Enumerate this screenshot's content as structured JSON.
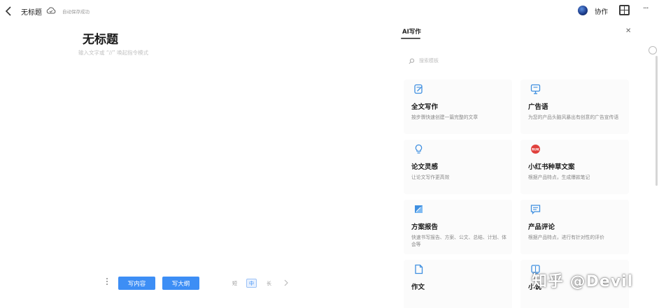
{
  "topbar": {
    "doc_name": "无标题",
    "save_status": "自动保存成功",
    "collab_label": "协作"
  },
  "editor": {
    "title": "无标题",
    "placeholder": "输入文字或 “//” 唤起指令模式"
  },
  "bottom_toolbar": {
    "write_content_label": "写内容",
    "write_outline_label": "写大纲",
    "lengths": [
      "短",
      "中",
      "长"
    ],
    "selected_length": "中"
  },
  "ai_panel": {
    "tab_label": "AI写作",
    "search_placeholder": "搜索模板",
    "cards": [
      {
        "title": "全文写作",
        "desc": "按步骤快速创建一篇完整的文章",
        "icon": "pencil-doc-icon"
      },
      {
        "title": "广告语",
        "desc": "为您的产品头脑风暴出有创意的广告宣传语",
        "icon": "billboard-icon"
      },
      {
        "title": "论文灵感",
        "desc": "让论文写作更高效",
        "icon": "lightbulb-icon"
      },
      {
        "title": "小红书种草文案",
        "desc": "根据产品特点，生成爆款笔记",
        "icon": "xiaohongshu-icon",
        "icon_text": "RUK"
      },
      {
        "title": "方案报告",
        "desc": "快速书写报告、方案、公文、总结、计划、体会等",
        "icon": "report-icon"
      },
      {
        "title": "产品评论",
        "desc": "根据产品特点，进行有针对性的评价",
        "icon": "comment-icon"
      },
      {
        "title": "作文",
        "desc": "",
        "icon": "document-icon"
      },
      {
        "title": "小说",
        "desc": "",
        "icon": "book-icon"
      }
    ]
  },
  "watermark": "知乎 @Devil",
  "colors": {
    "accent": "#3d8ef5",
    "icon_blue": "#3f8fe0",
    "xiaohongshu_red": "#e0403c"
  }
}
